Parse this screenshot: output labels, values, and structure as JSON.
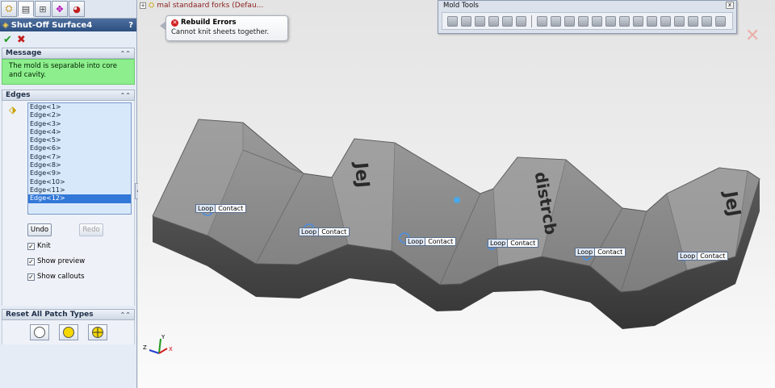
{
  "panel": {
    "tabs": [
      "feature-manager",
      "property-manager",
      "configuration-manager",
      "dimxpert-manager",
      "display-manager"
    ],
    "title": "Shut-Off Surface4",
    "help": "?",
    "message_group": {
      "header": "Message",
      "text": "The mold is separable into core and cavity."
    },
    "edges_group": {
      "header": "Edges",
      "items": [
        "Edge<1>",
        "Edge<2>",
        "Edge<3>",
        "Edge<4>",
        "Edge<5>",
        "Edge<6>",
        "Edge<7>",
        "Edge<8>",
        "Edge<9>",
        "Edge<10>",
        "Edge<11>",
        "Edge<12>"
      ],
      "selected_index": 11,
      "undo_label": "Undo",
      "redo_label": "Redo",
      "knit_label": "Knit",
      "show_preview_label": "Show preview",
      "show_callouts_label": "Show callouts"
    },
    "patch_group": {
      "header": "Reset All Patch Types"
    }
  },
  "viewport": {
    "tree_item": "mal standaard forks  (Defau...",
    "error_tooltip": {
      "title": "Rebuild Errors",
      "body": "Cannot knit sheets together."
    },
    "mold_tools": {
      "title": "Mold Tools",
      "close": "x"
    },
    "callouts": [
      {
        "key": "Loop",
        "value": "Contact"
      },
      {
        "key": "Loop",
        "value": "Contact"
      },
      {
        "key": "Loop",
        "value": "Contact"
      },
      {
        "key": "Loop",
        "value": "Contact"
      },
      {
        "key": "Loop",
        "value": "Contact"
      },
      {
        "key": "Loop",
        "value": "Contact"
      }
    ],
    "triad": {
      "x": "X",
      "y": "Y",
      "z": "Z"
    },
    "emboss_text": [
      "JeJ",
      "distrcb",
      "JeJ"
    ]
  }
}
